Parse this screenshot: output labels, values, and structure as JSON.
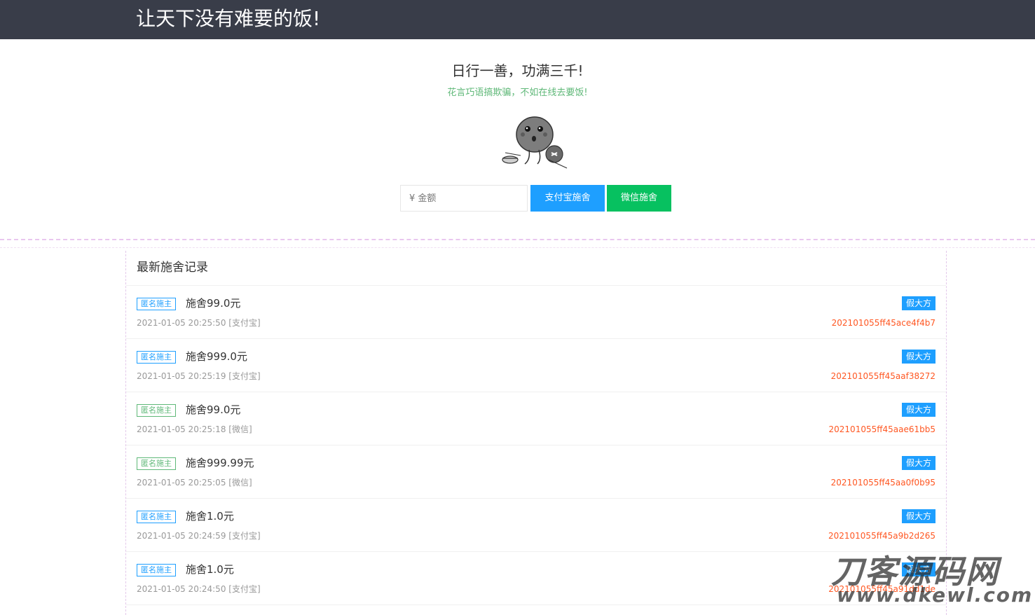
{
  "header": {
    "title": "让天下没有难要的饭!"
  },
  "hero": {
    "slogan": "日行一善，功满三千!",
    "subslogan": "花言巧语搞欺骗，不如在线去要饭!"
  },
  "donate": {
    "amount_placeholder": "¥ 金额",
    "alipay_label": "支付宝施舍",
    "wechat_label": "微信施舍"
  },
  "records": {
    "title": "最新施舍记录",
    "items": [
      {
        "tag": "匿名施主",
        "amount": "施舍99.0元",
        "time": "2021-01-05 20:25:50 [支付宝]",
        "badge": "假大方",
        "order": "202101055ff45ace4f4b7",
        "channel": "alipay"
      },
      {
        "tag": "匿名施主",
        "amount": "施舍999.0元",
        "time": "2021-01-05 20:25:19 [支付宝]",
        "badge": "假大方",
        "order": "202101055ff45aaf38272",
        "channel": "alipay"
      },
      {
        "tag": "匿名施主",
        "amount": "施舍99.0元",
        "time": "2021-01-05 20:25:18 [微信]",
        "badge": "假大方",
        "order": "202101055ff45aae61bb5",
        "channel": "wechat"
      },
      {
        "tag": "匿名施主",
        "amount": "施舍999.99元",
        "time": "2021-01-05 20:25:05 [微信]",
        "badge": "假大方",
        "order": "202101055ff45aa0f0b95",
        "channel": "wechat"
      },
      {
        "tag": "匿名施主",
        "amount": "施舍1.0元",
        "time": "2021-01-05 20:24:59 [支付宝]",
        "badge": "假大方",
        "order": "202101055ff45a9b2d265",
        "channel": "alipay"
      },
      {
        "tag": "匿名施主",
        "amount": "施舍1.0元",
        "time": "2021-01-05 20:24:50 [支付宝]",
        "badge": "假大方",
        "order": "202101055ff45a91dd1de",
        "channel": "alipay"
      }
    ]
  },
  "watermark": {
    "cn": "刀客源码网",
    "en": "www.dkewl.com"
  },
  "colors": {
    "topbar": "#393d49",
    "alipay_blue": "#1e9fff",
    "wechat_green": "#07c160",
    "tag_green": "#5fb878",
    "order_red": "#ff5722"
  },
  "icons": {
    "hero_image": "beggar-emoji-icon"
  }
}
